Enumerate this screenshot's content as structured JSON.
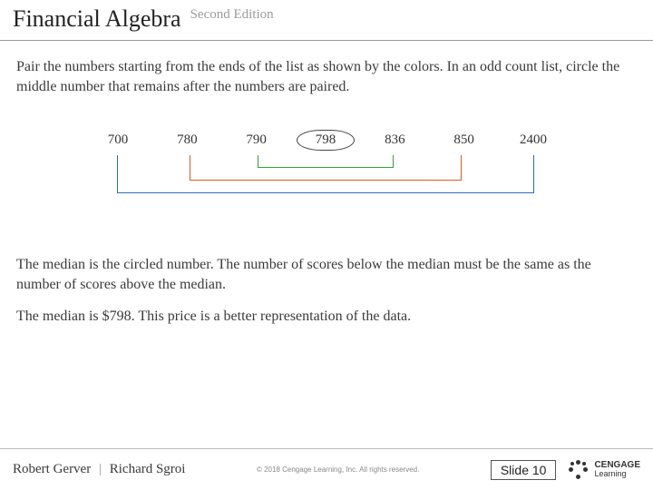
{
  "header": {
    "title": "Financial Algebra",
    "edition": "Second Edition"
  },
  "body": {
    "intro": "Pair the numbers starting from the ends of the list as shown by the colors. In an odd count list, circle the middle number that remains after the numbers are paired.",
    "numbers": {
      "n0": "700",
      "n1": "780",
      "n2": "790",
      "n3": "798",
      "n4": "836",
      "n5": "850",
      "n6": "2400"
    },
    "para2": "The median is the circled number. The number of scores below the median must be the same as the number of scores above the median.",
    "para3": "The median is $798. This price is a better representation of the data."
  },
  "footer": {
    "author1": "Robert Gerver",
    "author2": "Richard Sgroi",
    "copyright": "© 2018 Cengage Learning, Inc. All rights reserved.",
    "slide": "Slide 10",
    "brand_top": "CENGAGE",
    "brand_sub": "Learning"
  }
}
